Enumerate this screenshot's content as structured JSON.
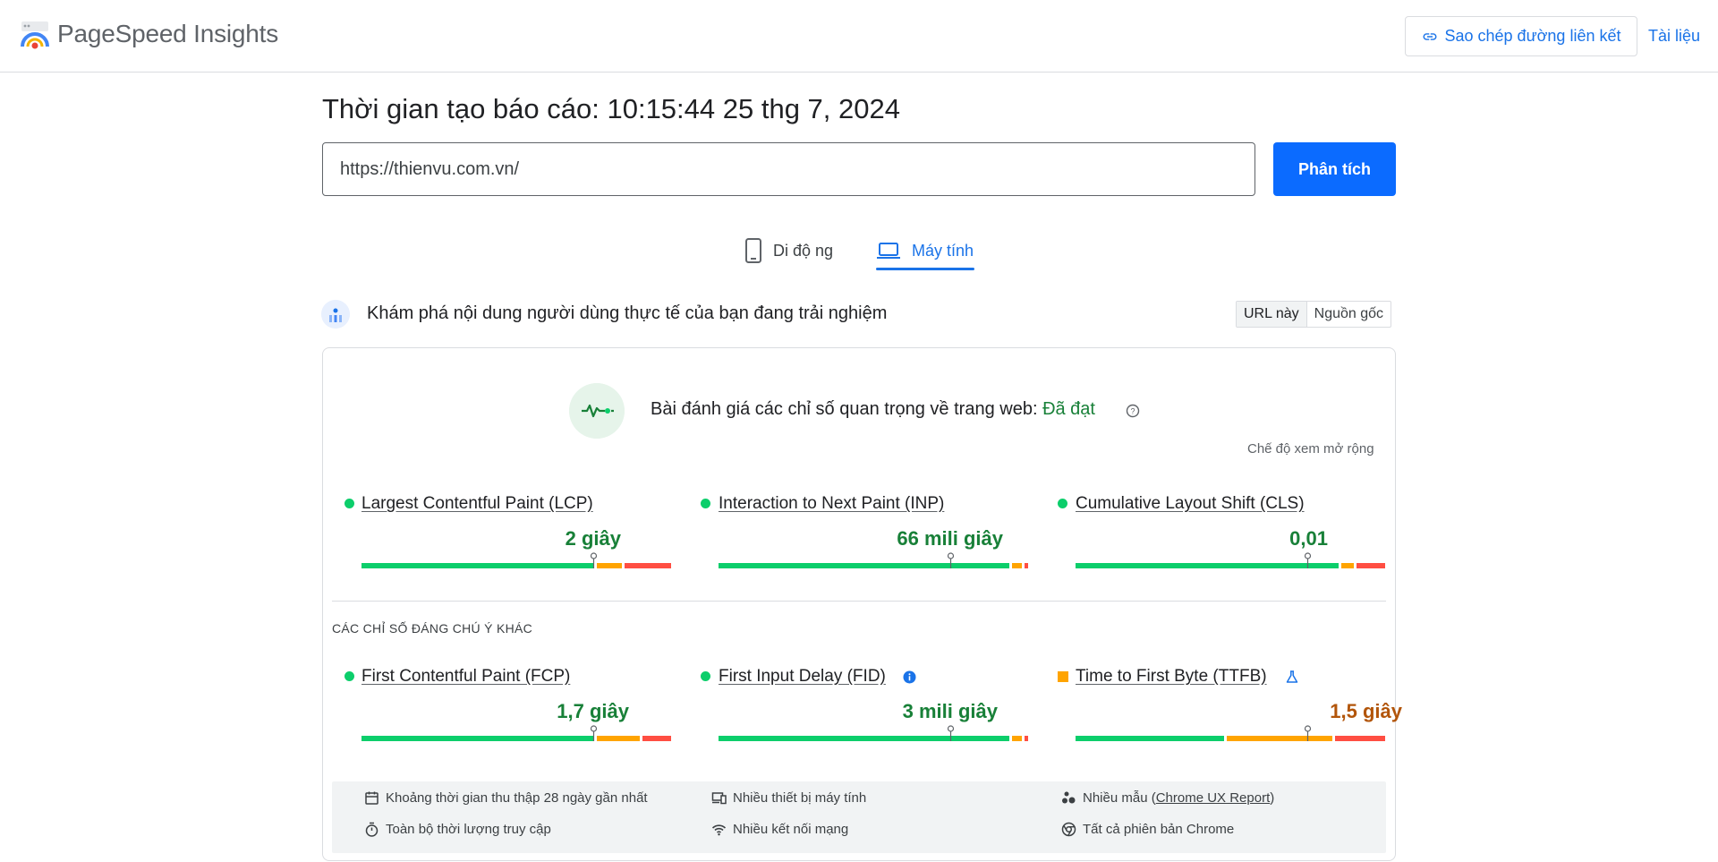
{
  "header": {
    "brand": "PageSpeed Insights",
    "copy_link_label": "Sao chép đường liên kết",
    "docs_label": "Tài liệu"
  },
  "report": {
    "time_label": "Thời gian tạo báo cáo: 10:15:44 25 thg 7, 2024",
    "url": "https://thienvu.com.vn/",
    "analyze_label": "Phân tích"
  },
  "tabs": {
    "mobile": "Di độ ng",
    "desktop": "Máy tính",
    "active": "desktop"
  },
  "crux": {
    "heading": "Khám phá nội dung người dùng thực tế của bạn đang trải nghiệm",
    "toggle": [
      "URL này",
      "Nguồn gốc"
    ],
    "active_toggle": "URL này"
  },
  "cwv": {
    "title_prefix": "Bài đánh giá các chỉ số quan trọng về trang web: ",
    "status": "Đã đạt",
    "expand_label": "Chế độ xem mở rộng"
  },
  "core_metrics": [
    {
      "name": "Largest Contentful Paint (LCP)",
      "value": "2 giây",
      "rating": "good",
      "dist": [
        0.75,
        0.09,
        0.16
      ],
      "marker": 0.75
    },
    {
      "name": "Interaction to Next Paint (INP)",
      "value": "66 mili giây",
      "rating": "good",
      "dist": [
        0.94,
        0.04,
        0.02
      ],
      "marker": 0.75
    },
    {
      "name": "Cumulative Layout Shift (CLS)",
      "value": "0,01",
      "rating": "good",
      "dist": [
        0.85,
        0.05,
        0.1
      ],
      "marker": 0.75
    }
  ],
  "other_heading": "CÁC CHỈ SỐ ĐÁNG CHÚ Ý KHÁC",
  "other_metrics": [
    {
      "name": "First Contentful Paint (FCP)",
      "value": "1,7 giây",
      "rating": "good",
      "dist": [
        0.75,
        0.15,
        0.1
      ],
      "marker": 0.75
    },
    {
      "name": "First Input Delay (FID)",
      "value": "3 mili giây",
      "rating": "good",
      "dist": [
        0.94,
        0.04,
        0.02
      ],
      "marker": 0.75
    },
    {
      "name": "Time to First Byte (TTFB)",
      "value": "1,5 giây",
      "rating": "average",
      "dist": [
        0.48,
        0.35,
        0.17
      ],
      "marker": 0.75
    }
  ],
  "footer": {
    "period": "Khoảng thời gian thu thập 28 ngày gần nhất",
    "duration": "Toàn bộ thời lượng truy cập",
    "devices": "Nhiều thiết bị máy tính",
    "network": "Nhiều kết nối mạng",
    "samples_prefix": "Nhiều mẫu (",
    "samples_link": "Chrome UX Report",
    "samples_suffix": ")",
    "chrome": "Tất cả phiên bản Chrome"
  },
  "colors": {
    "accent": "#1a73e8",
    "analyze_bg": "#0b6bff",
    "good": "#0cce6b",
    "average": "#ffa400",
    "poor": "#ff4e42",
    "good_text": "#188038",
    "average_text": "#b2550a"
  }
}
